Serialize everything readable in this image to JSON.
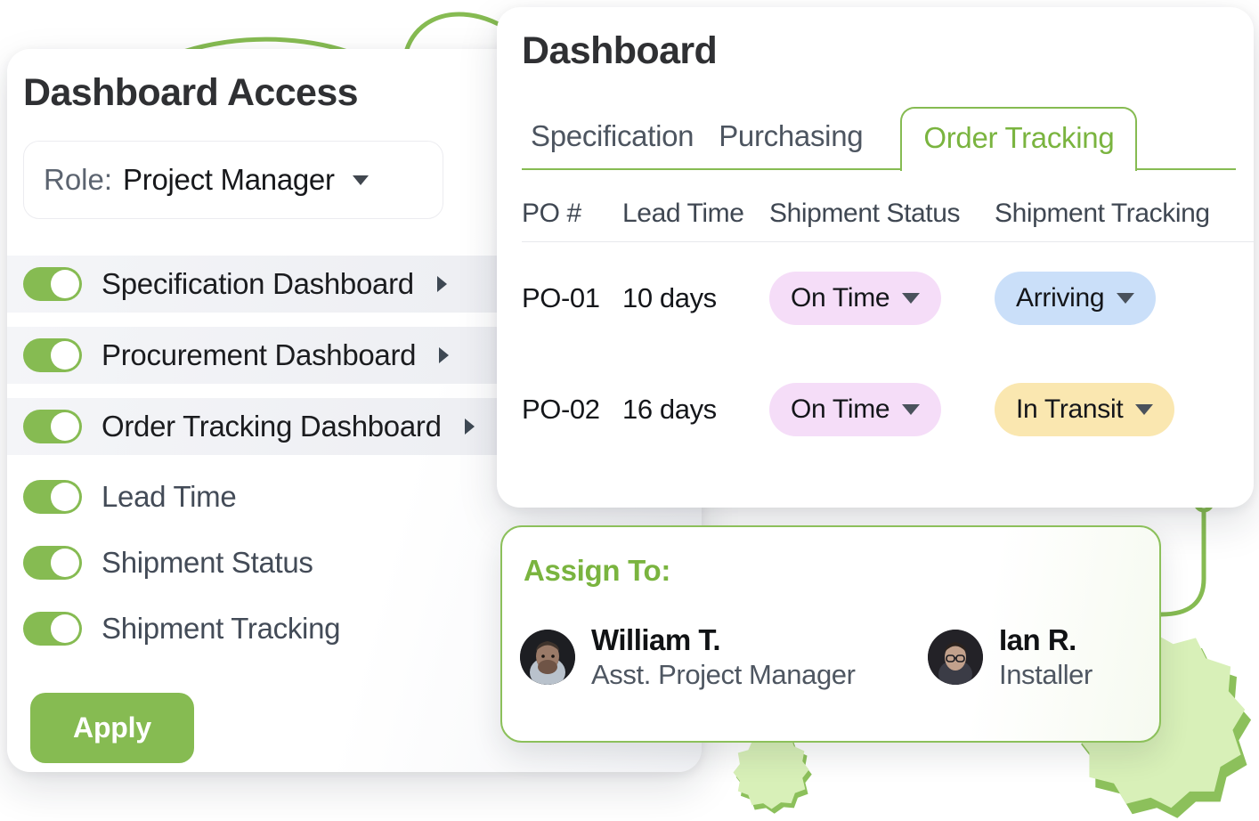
{
  "access_panel": {
    "title": "Dashboard Access",
    "role_label": "Role:",
    "role_value": "Project Manager",
    "role_caret_icon": "chevron-down-icon",
    "items": [
      {
        "label": "Specification Dashboard",
        "enabled": true,
        "grouped": true,
        "expand_icon": "chevron-right-icon"
      },
      {
        "label": "Procurement Dashboard",
        "enabled": true,
        "grouped": true,
        "expand_icon": "chevron-right-icon"
      },
      {
        "label": "Order Tracking Dashboard",
        "enabled": true,
        "grouped": true,
        "expand_icon": "chevron-right-icon"
      },
      {
        "label": "Lead Time",
        "enabled": true,
        "grouped": false
      },
      {
        "label": "Shipment Status",
        "enabled": true,
        "grouped": false
      },
      {
        "label": "Shipment Tracking",
        "enabled": true,
        "grouped": false
      }
    ],
    "apply_label": "Apply"
  },
  "dashboard_panel": {
    "title": "Dashboard",
    "tabs": [
      {
        "label": "Specification",
        "active": false
      },
      {
        "label": "Purchasing",
        "active": false
      },
      {
        "label": "Order Tracking",
        "active": true
      }
    ],
    "table": {
      "columns": [
        "PO #",
        "Lead Time",
        "Shipment Status",
        "Shipment Tracking"
      ],
      "rows": [
        {
          "po": "PO-01",
          "lead_time": "10 days",
          "shipment_status": "On Time",
          "shipment_status_color": "#f5ddf8",
          "shipment_tracking": "Arriving",
          "shipment_tracking_color": "#cadff9"
        },
        {
          "po": "PO-02",
          "lead_time": "16 days",
          "shipment_status": "On Time",
          "shipment_status_color": "#f5ddf8",
          "shipment_tracking": "In Transit",
          "shipment_tracking_color": "#fae7b0"
        }
      ]
    }
  },
  "assign_card": {
    "heading": "Assign To:",
    "people": [
      {
        "name": "William T.",
        "role": "Asst. Project Manager",
        "avatar": "avatar-william"
      },
      {
        "name": "Ian R.",
        "role": "Installer",
        "avatar": "avatar-ian"
      }
    ]
  },
  "theme": {
    "accent_green": "#86bb52",
    "accent_green_text": "#7ab43f",
    "gear_green": "#d8f0b8",
    "gear_shadow_green": "#8cc05b"
  },
  "decorations": [
    {
      "name": "curve-line-top",
      "color": "#86bb52"
    },
    {
      "name": "node-line-right",
      "color": "#86bb52"
    },
    {
      "name": "gear-large",
      "color": "#d8f0b8"
    },
    {
      "name": "gear-small",
      "color": "#d8f0b8"
    }
  ]
}
